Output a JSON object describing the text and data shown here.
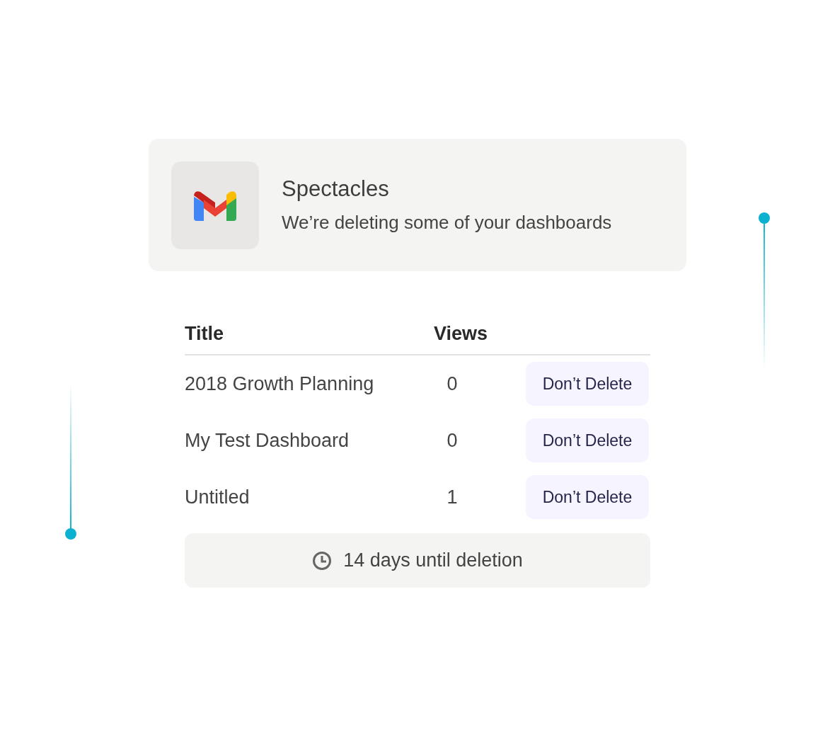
{
  "notification": {
    "app": "Spectacles",
    "message": "We’re deleting some of your dashboards"
  },
  "table": {
    "columns": [
      "Title",
      "Views"
    ],
    "rows": [
      {
        "title": "2018 Growth Planning",
        "views": "0",
        "action": "Don’t Delete"
      },
      {
        "title": "My Test Dashboard",
        "views": "0",
        "action": "Don’t Delete"
      },
      {
        "title": "Untitled",
        "views": "1",
        "action": "Don’t Delete"
      }
    ]
  },
  "footer": {
    "text": "14 days until deletion"
  }
}
